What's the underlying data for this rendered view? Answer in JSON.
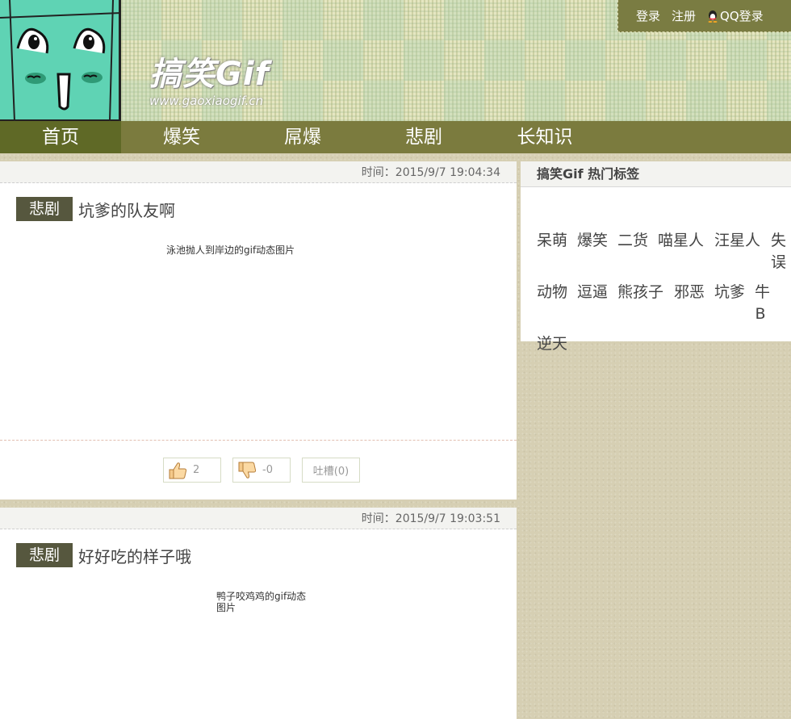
{
  "header": {
    "logo_title": "搞笑Gif",
    "logo_url": "www.gaoxiaogif.cn",
    "auth": {
      "login": "登录",
      "register": "注册",
      "qq_login": "QQ登录"
    }
  },
  "nav": {
    "items": [
      {
        "label": "首页"
      },
      {
        "label": "爆笑"
      },
      {
        "label": "屌爆"
      },
      {
        "label": "悲剧"
      },
      {
        "label": "长知识"
      }
    ]
  },
  "posts": [
    {
      "time": "时间：2015/9/7 19:04:34",
      "category": "悲剧",
      "title": "坑爹的队友啊",
      "image_alt": "泳池抛人到岸边的gif动态图片",
      "likes": "2",
      "dislikes": "-0",
      "comments": "吐槽(0)"
    },
    {
      "time": "时间：2015/9/7 19:03:51",
      "category": "悲剧",
      "title": "好好吃的样子哦",
      "image_alt": "鸭子咬鸡鸡的gif动态图片"
    }
  ],
  "sidebar": {
    "title": "搞笑Gif 热门标签",
    "tags": [
      "呆萌",
      "爆笑",
      "二货",
      "喵星人",
      "汪星人",
      "失误",
      "动物",
      "逗逼",
      "熊孩子",
      "邪恶",
      "坑爹",
      "牛B",
      "逆天"
    ]
  },
  "colors": {
    "nav_bg": "#7b7b3e",
    "nav_active": "#5f6926",
    "badge": "#56573e",
    "face": "#5fd3b4"
  }
}
